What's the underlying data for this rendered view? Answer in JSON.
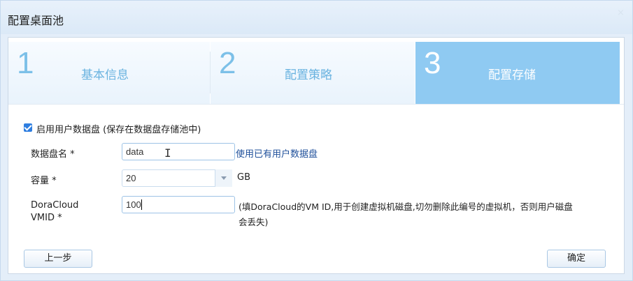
{
  "dialog": {
    "title": "配置桌面池",
    "close_glyph": "×"
  },
  "steps": [
    {
      "number": "1",
      "label": "基本信息",
      "active": false
    },
    {
      "number": "2",
      "label": "配置策略",
      "active": false
    },
    {
      "number": "3",
      "label": "配置存储",
      "active": true
    }
  ],
  "form": {
    "enable_user_disk_label": "启用用户数据盘 (保存在数据盘存储池中)",
    "enable_user_disk_checked": true,
    "disk_name_label": "数据盘名 *",
    "disk_name_value": "data",
    "use_existing_link": "使用已有用户数据盘",
    "capacity_label": "容量 *",
    "capacity_value": "20",
    "capacity_unit": "GB",
    "vmid_label_line1": "DoraCloud",
    "vmid_label_line2": "VMID *",
    "vmid_value": "100",
    "vmid_hint_line1": "(填DoraCloud的VM ID,用于创建虚拟机磁盘,切勿删除此编号的虚拟机，否则用户磁盘",
    "vmid_hint_line2": "会丢失)"
  },
  "buttons": {
    "prev": "上一步",
    "confirm": "确定"
  },
  "colors": {
    "accent": "#8fcaf2",
    "step_text": "#6ab3e0",
    "checkbox": "#2f7ee0",
    "link": "#1e4f9a"
  }
}
